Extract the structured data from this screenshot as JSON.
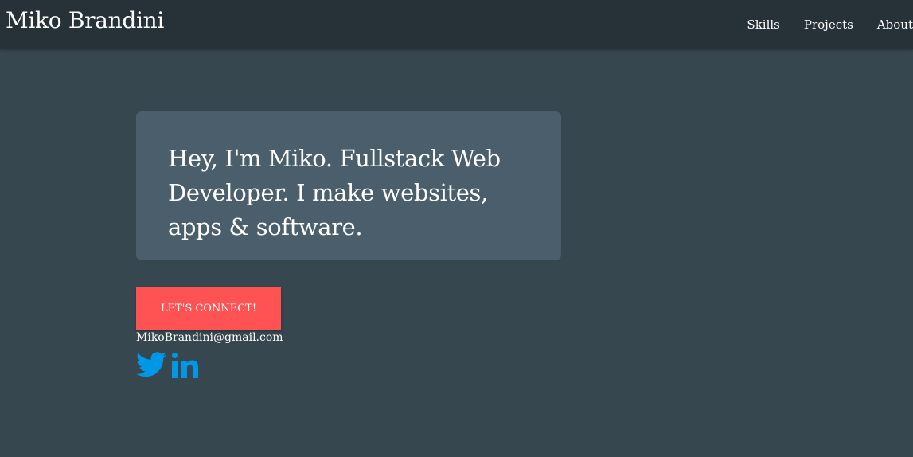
{
  "navbar": {
    "brand": "Miko Brandini",
    "links": [
      {
        "label": "Skills"
      },
      {
        "label": "Projects"
      },
      {
        "label": "About"
      }
    ]
  },
  "hero": {
    "headline": "Hey, I'm Miko. Fullstack Web Developer. I make websites, apps & software."
  },
  "contact": {
    "button_label": "LET'S CONNECT!",
    "email": "MikoBrandini@gmail.com"
  },
  "social": {
    "icons": [
      "twitter-icon",
      "linkedin-icon"
    ]
  },
  "colors": {
    "navbar_bg": "#263238",
    "page_bg": "#37474f",
    "card_bg": "#4a5f6b",
    "accent": "#ff5252",
    "social_icon": "#0097e6"
  }
}
